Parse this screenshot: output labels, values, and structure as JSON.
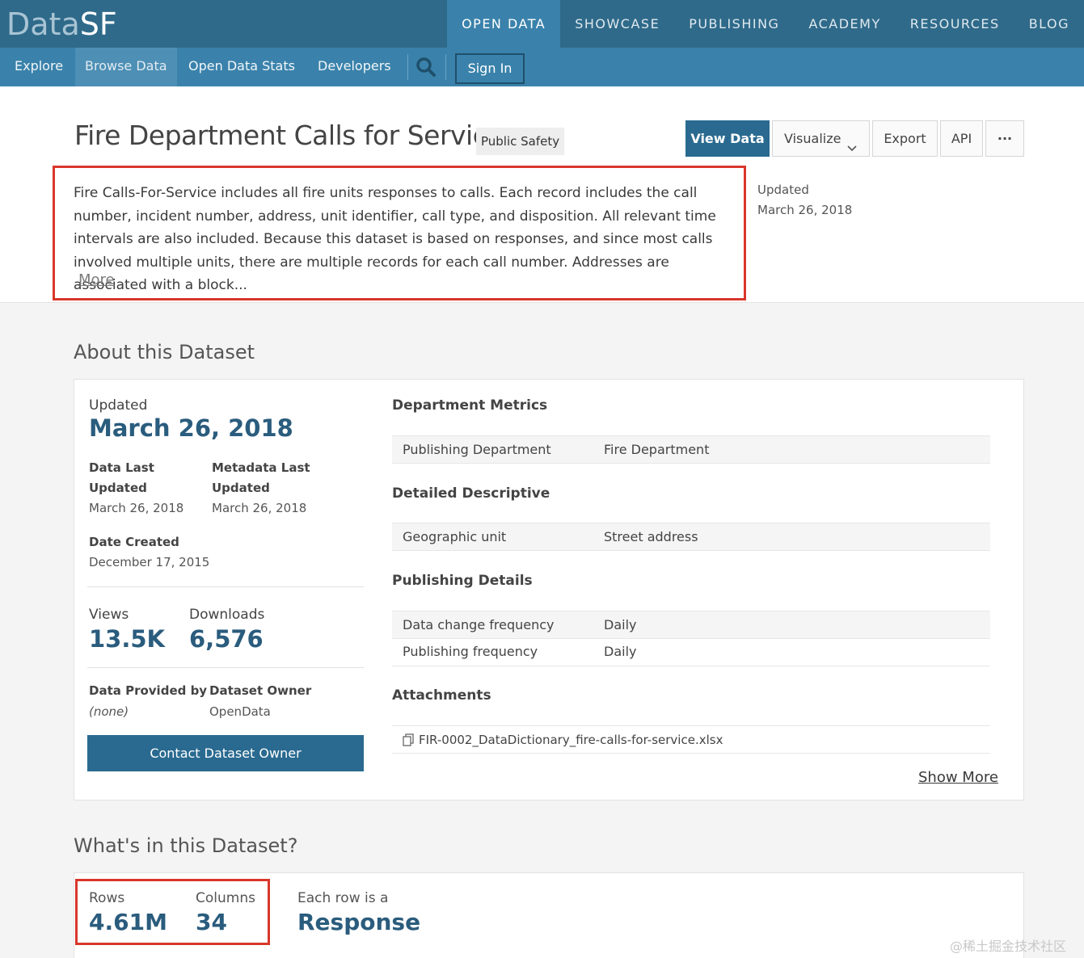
{
  "brand": {
    "data": "Data",
    "sf": "SF"
  },
  "top_nav": [
    "OPEN DATA",
    "SHOWCASE",
    "PUBLISHING",
    "ACADEMY",
    "RESOURCES",
    "BLOG"
  ],
  "sub_nav": {
    "explore": "Explore",
    "browse": "Browse Data",
    "stats": "Open Data Stats",
    "developers": "Developers",
    "sign_in": "Sign In"
  },
  "dataset": {
    "title": "Fire Department Calls for Service",
    "category": "Public Safety",
    "description": "Fire Calls-For-Service includes all fire units responses to calls. Each record includes the call number, incident number, address, unit identifier, call type, and disposition. All relevant time intervals are also included. Because this dataset is based on responses, and since most calls involved multiple units, there are multiple records for each call number. Addresses are associated with a block...",
    "more": "More",
    "updated_label": "Updated",
    "updated_value": "March 26, 2018"
  },
  "actions": {
    "view_data": "View Data",
    "visualize": "Visualize",
    "export": "Export",
    "api": "API",
    "more": "···"
  },
  "about": {
    "heading": "About this Dataset",
    "updated_label": "Updated",
    "updated_date": "March 26, 2018",
    "data_last_updated_label": "Data Last Updated",
    "data_last_updated": "March 26, 2018",
    "metadata_last_updated_label": "Metadata Last Updated",
    "metadata_last_updated": "March 26, 2018",
    "date_created_label": "Date Created",
    "date_created": "December 17, 2015",
    "views_label": "Views",
    "views": "13.5K",
    "downloads_label": "Downloads",
    "downloads": "6,576",
    "provided_by_label": "Data Provided by",
    "provided_by": "(none)",
    "owner_label": "Dataset Owner",
    "owner": "OpenData",
    "contact_button": "Contact Dataset Owner"
  },
  "metrics": {
    "dept_heading": "Department Metrics",
    "publishing_department_key": "Publishing Department",
    "publishing_department_val": "Fire Department",
    "detailed_heading": "Detailed Descriptive",
    "geo_key": "Geographic unit",
    "geo_val": "Street address",
    "publishing_heading": "Publishing Details",
    "change_freq_key": "Data change frequency",
    "change_freq_val": "Daily",
    "pub_freq_key": "Publishing frequency",
    "pub_freq_val": "Daily",
    "attachments_heading": "Attachments",
    "attachment_file": "FIR-0002_DataDictionary_fire-calls-for-service.xlsx",
    "show_more": "Show More"
  },
  "whats_in": {
    "heading": "What's in this Dataset?",
    "rows_label": "Rows",
    "rows": "4.61M",
    "columns_label": "Columns",
    "columns": "34",
    "each_row_label": "Each row is a",
    "each_row": "Response"
  },
  "watermark": "@稀土掘金技术社区"
}
